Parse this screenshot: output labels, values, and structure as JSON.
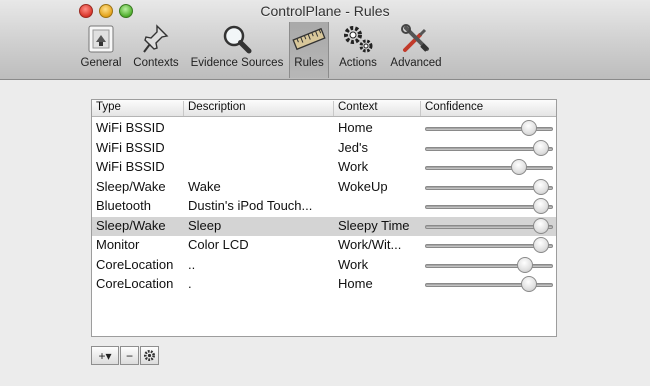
{
  "window": {
    "title": "ControlPlane - Rules"
  },
  "toolbar": {
    "items": [
      {
        "label": "General",
        "icon": "switch-icon"
      },
      {
        "label": "Contexts",
        "icon": "pushpin-icon"
      },
      {
        "label": "Evidence Sources",
        "icon": "magnifier-icon"
      },
      {
        "label": "Rules",
        "icon": "ruler-icon",
        "selected": true
      },
      {
        "label": "Actions",
        "icon": "gears-icon"
      },
      {
        "label": "Advanced",
        "icon": "tools-icon"
      }
    ]
  },
  "table": {
    "headers": [
      "Type",
      "Description",
      "Context",
      "Confidence"
    ],
    "rows": [
      {
        "type": "WiFi BSSID",
        "description": "",
        "context": "Home",
        "confidence": 0.86
      },
      {
        "type": "WiFi BSSID",
        "description": "",
        "context": "Jed's",
        "confidence": 0.96
      },
      {
        "type": "WiFi BSSID",
        "description": "",
        "context": "Work",
        "confidence": 0.77
      },
      {
        "type": "Sleep/Wake",
        "description": "Wake",
        "context": "WokeUp",
        "confidence": 0.96
      },
      {
        "type": "Bluetooth",
        "description": "Dustin's iPod Touch...",
        "context": "",
        "confidence": 0.96
      },
      {
        "type": "Sleep/Wake",
        "description": "Sleep",
        "context": "Sleepy Time",
        "confidence": 0.96,
        "selected": true
      },
      {
        "type": "Monitor",
        "description": "Color LCD",
        "context": "Work/Wit...",
        "confidence": 0.96
      },
      {
        "type": "CoreLocation",
        "description": "..",
        "context": "Work",
        "confidence": 0.82
      },
      {
        "type": "CoreLocation",
        "description": ".",
        "context": "Home",
        "confidence": 0.86
      }
    ]
  },
  "bottom_buttons": {
    "add": "+▾",
    "remove": "−",
    "settings": "settings-gear-icon"
  }
}
